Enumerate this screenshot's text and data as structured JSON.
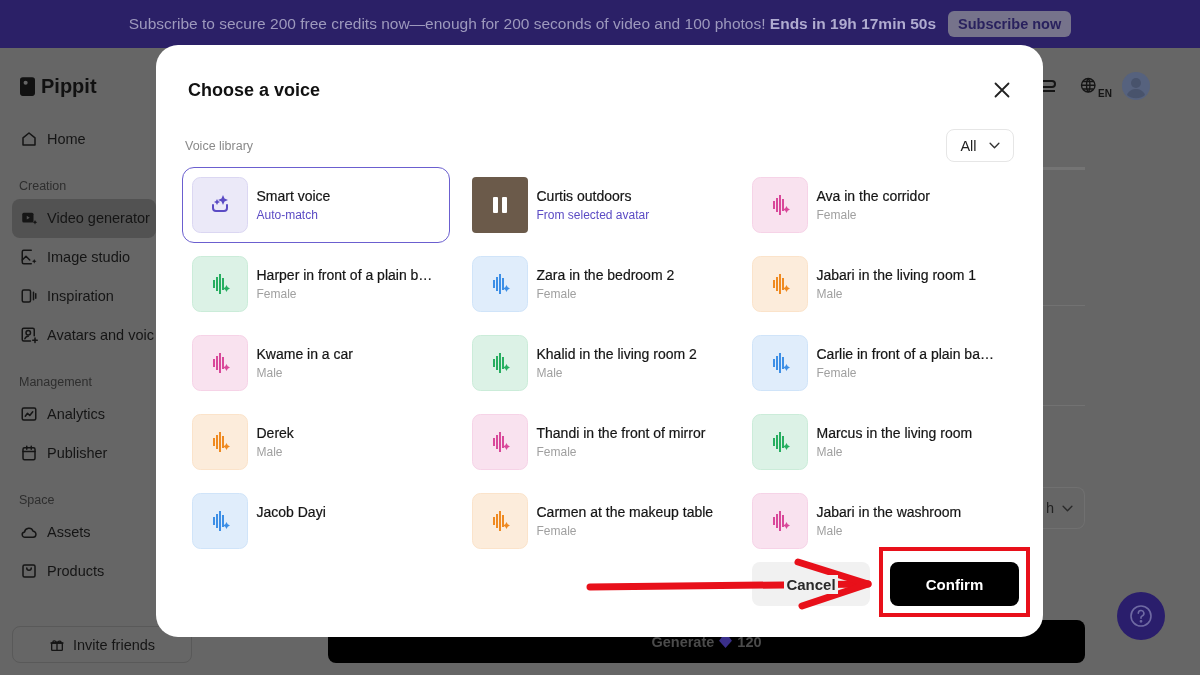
{
  "banner": {
    "text": "Subscribe to secure 200 free credits now—enough for 200 seconds of video and 100 photos! **Ends in 19h 17min 50s**",
    "button": "Subscribe now"
  },
  "sidebar": {
    "logo": "Pippit",
    "groups": [
      {
        "items": [
          {
            "label": "Home",
            "selected": false
          }
        ]
      },
      {
        "label": "Creation",
        "items": [
          {
            "label": "Video generator",
            "selected": true
          },
          {
            "label": "Image studio",
            "selected": false
          },
          {
            "label": "Inspiration",
            "selected": false
          },
          {
            "label": "Avatars and voic",
            "selected": false
          }
        ]
      },
      {
        "label": "Management",
        "items": [
          {
            "label": "Analytics",
            "selected": false
          },
          {
            "label": "Publisher",
            "selected": false
          }
        ]
      },
      {
        "label": "Space",
        "items": [
          {
            "label": "Assets",
            "selected": false
          },
          {
            "label": "Products",
            "selected": false
          }
        ]
      }
    ],
    "invite": "Invite friends"
  },
  "topbar": {
    "language": "EN"
  },
  "main": {
    "dropdown_value": "h",
    "generate": {
      "label": "Generate",
      "credits": "120"
    }
  },
  "dialog": {
    "title": "Choose a voice",
    "section": "Voice library",
    "filter": "All",
    "voices": [
      {
        "name": "Smart voice",
        "subtitle": "Auto-match",
        "kind": "smart",
        "color": "#5b4bc4",
        "selected": true
      },
      {
        "name": "Curtis outdoors",
        "subtitle": "From selected avatar",
        "kind": "avatar",
        "color": "#6b5a4a",
        "selected": false
      },
      {
        "name": "Ava in the corridor",
        "subtitle": "Female",
        "kind": "voice",
        "color": "#d9489a",
        "selected": false
      },
      {
        "name": "Harper in front of a plain b…",
        "subtitle": "Female",
        "kind": "voice",
        "color": "#27ae60",
        "selected": false
      },
      {
        "name": "Zara in the bedroom 2",
        "subtitle": "Female",
        "kind": "voice",
        "color": "#3d8fe6",
        "selected": false
      },
      {
        "name": "Jabari in the living room 1",
        "subtitle": "Male",
        "kind": "voice",
        "color": "#ef8a21",
        "selected": false
      },
      {
        "name": "Kwame in a car",
        "subtitle": "Male",
        "kind": "voice",
        "color": "#d9489a",
        "selected": false
      },
      {
        "name": "Khalid in the living room 2",
        "subtitle": "Male",
        "kind": "voice",
        "color": "#27ae60",
        "selected": false
      },
      {
        "name": "Carlie in front of a plain ba…",
        "subtitle": "Female",
        "kind": "voice",
        "color": "#3d8fe6",
        "selected": false
      },
      {
        "name": "Derek",
        "subtitle": "Male",
        "kind": "voice",
        "color": "#ef8a21",
        "selected": false
      },
      {
        "name": "Thandi in the front of mirror",
        "subtitle": "Female",
        "kind": "voice",
        "color": "#d9489a",
        "selected": false
      },
      {
        "name": "Marcus in the living room",
        "subtitle": "Male",
        "kind": "voice",
        "color": "#27ae60",
        "selected": false
      },
      {
        "name": "Jacob Dayi",
        "kind": "voice",
        "color": "#3d8fe6",
        "selected": false
      },
      {
        "name": "Carmen at the makeup table",
        "subtitle": "Female",
        "kind": "voice",
        "color": "#ef8a21",
        "selected": false
      },
      {
        "name": "Jabari in the washroom",
        "subtitle": "Male",
        "kind": "voice",
        "color": "#d9489a",
        "selected": false
      }
    ],
    "buttons": [
      {
        "label": "Cancel",
        "kind": "secondary",
        "highlighted": false
      },
      {
        "label": "Confirm",
        "kind": "primary",
        "highlighted": true
      }
    ]
  }
}
